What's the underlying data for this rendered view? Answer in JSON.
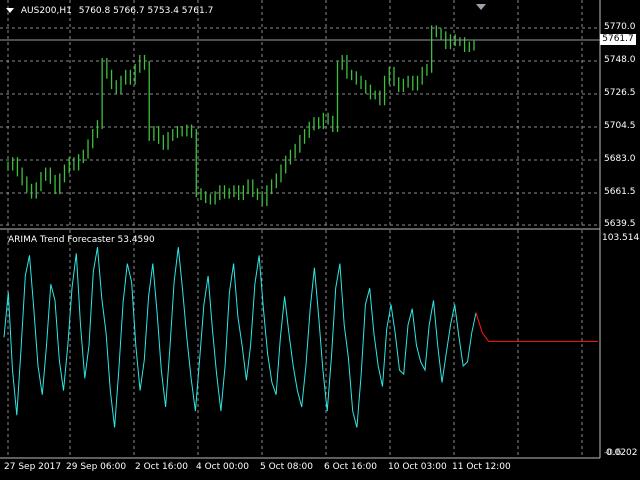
{
  "header": {
    "symbol": "AUS200,H1",
    "ohlc": "5760.8 5766.7 5753.4 5761.7"
  },
  "price_axis": {
    "labels": [
      "5770.0",
      "5748.0",
      "5726.5",
      "5704.5",
      "5683.0",
      "5661.5",
      "5639.5"
    ],
    "current_price": "5761.7"
  },
  "indicator": {
    "title": "ARIMA Trend Forecaster 53.4590",
    "axis_top": "103.5142",
    "axis_bottom": "0.0202",
    "axis_bottom_overlay": "-0.6"
  },
  "time_axis": {
    "labels": [
      "27 Sep 2017",
      "29 Sep 06:00",
      "2 Oct 16:00",
      "4 Oct 00:00",
      "5 Oct 08:00",
      "6 Oct 16:00",
      "10 Oct 03:00",
      "11 Oct 12:00"
    ]
  },
  "colors": {
    "background": "#000000",
    "grid": "#8c8c8c",
    "price_bars": "#3fbf3f",
    "indicator_line": "#2ee6e6",
    "forecast_line": "#ff1a1a",
    "text": "#ffffff"
  },
  "chart_data": [
    {
      "type": "line",
      "name": "AUS200 H1 price (approx, by bar)",
      "ylim": [
        5639.5,
        5780.0
      ],
      "x": [
        0,
        1,
        2,
        3,
        4,
        5,
        6,
        7,
        8,
        9,
        10,
        11,
        12,
        13,
        14,
        15,
        16,
        17,
        18,
        19,
        20,
        21,
        22,
        23,
        24,
        25,
        26,
        27,
        28,
        29,
        30,
        31,
        32,
        33,
        34,
        35,
        36,
        37,
        38,
        39,
        40,
        41,
        42,
        43,
        44,
        45,
        46,
        47,
        48,
        49,
        50,
        51,
        52,
        53,
        54,
        55,
        56,
        57,
        58,
        59,
        60,
        61,
        62,
        63,
        64,
        65,
        66,
        67,
        68,
        69,
        70,
        71,
        72,
        73,
        74,
        75,
        76,
        77,
        78,
        79,
        80,
        81,
        82,
        83,
        84,
        85,
        86,
        87,
        88,
        89,
        90,
        91,
        92,
        93,
        94,
        95,
        96,
        97,
        98,
        99,
        100,
        101,
        102,
        103,
        104,
        105,
        106,
        107,
        108,
        109,
        110,
        111,
        112,
        113,
        114,
        115,
        116,
        117,
        118,
        119
      ],
      "values": [
        5680,
        5683,
        5676,
        5670,
        5665,
        5661,
        5666,
        5673,
        5676,
        5671,
        5664,
        5672,
        5678,
        5683,
        5680,
        5685,
        5688,
        5695,
        5702,
        5708,
        5750,
        5742,
        5735,
        5732,
        5738,
        5742,
        5738,
        5746,
        5752,
        5748,
        5700,
        5704,
        5698,
        5694,
        5700,
        5702,
        5704,
        5703,
        5705,
        5702,
        5662,
        5660,
        5658,
        5657,
        5660,
        5664,
        5661,
        5662,
        5664,
        5660,
        5664,
        5668,
        5662,
        5660,
        5656,
        5664,
        5668,
        5672,
        5678,
        5684,
        5688,
        5692,
        5698,
        5702,
        5707,
        5710,
        5708,
        5713,
        5711,
        5706,
        5748,
        5752,
        5742,
        5741,
        5738,
        5735,
        5732,
        5728,
        5728,
        5724,
        5738,
        5744,
        5737,
        5733,
        5736,
        5738,
        5734,
        5738,
        5744,
        5746,
        5772,
        5770,
        5768,
        5762,
        5766,
        5764,
        5764,
        5760,
        5761,
        5761.7
      ],
      "ylabel": ""
    },
    {
      "type": "line",
      "name": "ARIMA Trend Forecaster",
      "ylim": [
        0.0202,
        103.5142
      ],
      "values": [
        56,
        78,
        40,
        18,
        50,
        86,
        96,
        70,
        42,
        28,
        52,
        82,
        74,
        45,
        30,
        52,
        80,
        97,
        62,
        36,
        52,
        88,
        100,
        75,
        58,
        30,
        12,
        40,
        73,
        92,
        83,
        52,
        30,
        45,
        76,
        92,
        68,
        40,
        22,
        50,
        83,
        100,
        79,
        56,
        36,
        20,
        45,
        72,
        86,
        60,
        38,
        20,
        42,
        78,
        92,
        66,
        52,
        35,
        52,
        82,
        96,
        70,
        48,
        34,
        28,
        56,
        76,
        58,
        42,
        30,
        22,
        42,
        70,
        90,
        66,
        40,
        20,
        46,
        80,
        92,
        62,
        46,
        20,
        12,
        38,
        72,
        80,
        58,
        42,
        32,
        60,
        72,
        58,
        40,
        38,
        62,
        70,
        52,
        44,
        40,
        62,
        74,
        52,
        34,
        48,
        62,
        72,
        56,
        42,
        44,
        58,
        68
      ],
      "forecast": [
        68,
        58,
        54,
        54,
        54,
        54,
        54,
        54,
        54,
        54,
        54,
        54,
        54,
        54,
        54,
        54,
        54,
        54,
        54,
        54
      ]
    }
  ]
}
